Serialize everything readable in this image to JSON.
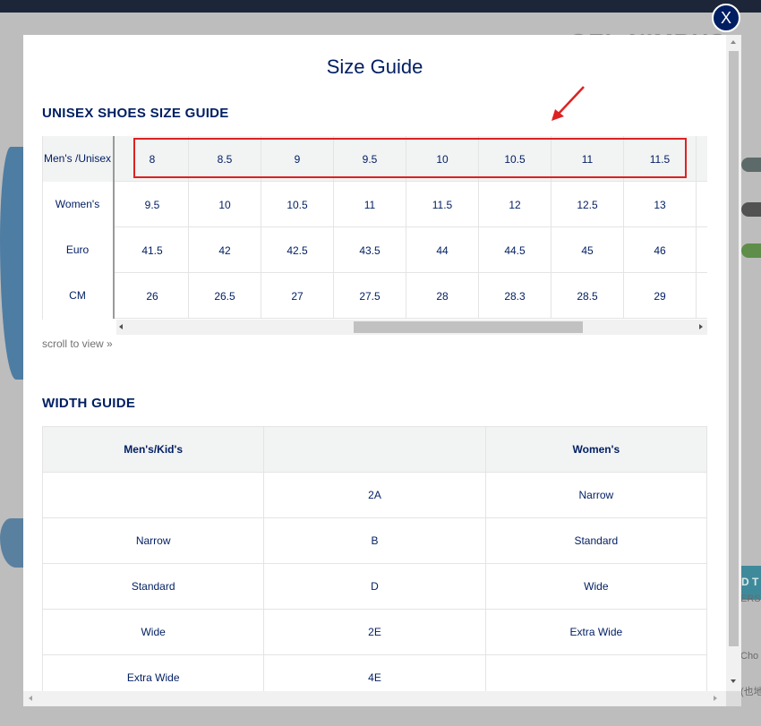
{
  "background": {
    "product_title": "GEL-NIMBUS",
    "right_button_text": "D T",
    "right_text_1": "ERS",
    "right_text_2": "Cho",
    "right_text_3": "(也地"
  },
  "modal": {
    "title": "Size Guide",
    "close_label": "X",
    "accent_color": "#001e62",
    "highlight_color": "#dd2222"
  },
  "size_guide": {
    "heading": "UNISEX SHOES SIZE GUIDE",
    "rows": [
      {
        "label_line1": "Men's /",
        "label_line2": "Unisex",
        "values": [
          "8",
          "8.5",
          "9",
          "9.5",
          "10",
          "10.5",
          "11",
          "11.5"
        ]
      },
      {
        "label_line1": "Women's",
        "label_line2": "",
        "values": [
          "9.5",
          "10",
          "10.5",
          "11",
          "11.5",
          "12",
          "12.5",
          "13"
        ]
      },
      {
        "label_line1": "Euro",
        "label_line2": "",
        "values": [
          "41.5",
          "42",
          "42.5",
          "43.5",
          "44",
          "44.5",
          "45",
          "46"
        ]
      },
      {
        "label_line1": "CM",
        "label_line2": "",
        "values": [
          "26",
          "26.5",
          "27",
          "27.5",
          "28",
          "28.3",
          "28.5",
          "29"
        ]
      }
    ],
    "scroll_hint": "scroll to view »"
  },
  "width_guide": {
    "heading": "WIDTH GUIDE",
    "headers": [
      "Men's/Kid's",
      "",
      "Women's"
    ],
    "rows": [
      [
        "",
        "2A",
        "Narrow"
      ],
      [
        "Narrow",
        "B",
        "Standard"
      ],
      [
        "Standard",
        "D",
        "Wide"
      ],
      [
        "Wide",
        "2E",
        "Extra Wide"
      ],
      [
        "Extra Wide",
        "4E",
        ""
      ]
    ]
  }
}
